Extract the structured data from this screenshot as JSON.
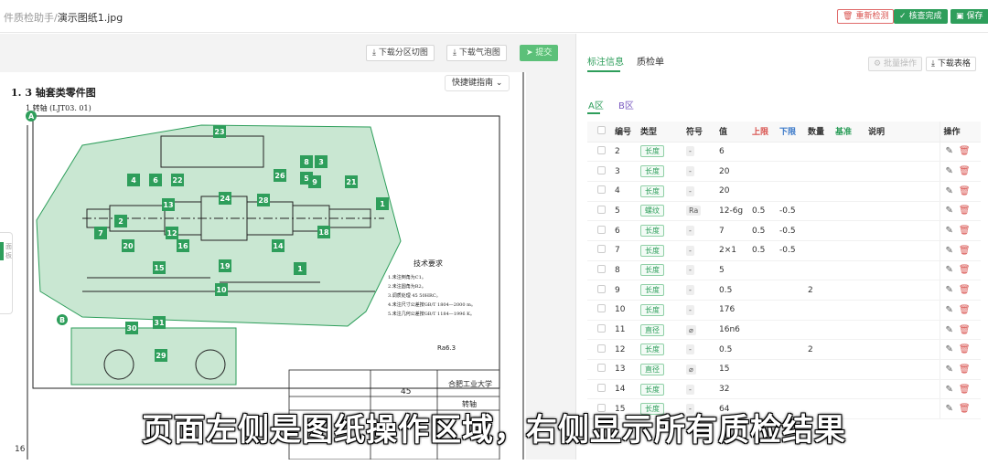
{
  "header": {
    "breadcrumb_parent": "件质检助手",
    "breadcrumb_sep": "/",
    "breadcrumb_current": "演示图纸1.jpg",
    "recheck_label": "重新检测",
    "complete_label": "核查完成",
    "save_label": "保存"
  },
  "drawing_toolbar": {
    "download_zones": "下载分区切图",
    "download_bubbles": "下载气泡图",
    "submit": "提交"
  },
  "drawing": {
    "shortcut_label": "快捷键指南",
    "section_title": "1. 3  轴套类零件图",
    "part_name": "1  转轴  (LJT03. 01)",
    "zone_a": "A",
    "zone_b": "B",
    "tech_title": "技术要求",
    "tech_lines": [
      "1.未注倒角为C1。",
      "2.未注圆角为R2。",
      "3.调质处理  45  50HRC。",
      "4.未注尺寸公差按GB/T 1804—2000  m。",
      "5.未注几何公差按GB/T 1184—1996  K。"
    ],
    "roughness": "Ra6.3",
    "material": "45",
    "school": "合肥工业大学",
    "drawing_name": "转轴",
    "sidetab_label": "面板",
    "page_number": "16",
    "bubbles": [
      "23",
      "4",
      "6",
      "22",
      "8",
      "3",
      "5",
      "26",
      "9",
      "21",
      "1",
      "13",
      "24",
      "28",
      "12",
      "20",
      "2",
      "7",
      "16",
      "14",
      "18",
      "15",
      "19",
      "1",
      "10",
      "30",
      "31",
      "29"
    ]
  },
  "panel": {
    "tab_marks": "标注信息",
    "tab_qc": "质检单",
    "batch_label": "批量操作",
    "download_table": "下载表格",
    "zone_a": "A区",
    "zone_b": "B区",
    "columns": [
      "编号",
      "类型",
      "符号",
      "值",
      "上限",
      "下限",
      "数量",
      "基准",
      "说明",
      "操作"
    ]
  },
  "rows": [
    {
      "id": "2",
      "type": "长度",
      "sym": "-",
      "val": "6",
      "up": "",
      "low": "",
      "qty": ""
    },
    {
      "id": "3",
      "type": "长度",
      "sym": "-",
      "val": "20",
      "up": "",
      "low": "",
      "qty": ""
    },
    {
      "id": "4",
      "type": "长度",
      "sym": "-",
      "val": "20",
      "up": "",
      "low": "",
      "qty": ""
    },
    {
      "id": "5",
      "type": "螺纹",
      "sym": "Ra",
      "val": "12-6g",
      "up": "0.5",
      "low": "-0.5",
      "qty": ""
    },
    {
      "id": "6",
      "type": "长度",
      "sym": "-",
      "val": "7",
      "up": "0.5",
      "low": "-0.5",
      "qty": ""
    },
    {
      "id": "7",
      "type": "长度",
      "sym": "-",
      "val": "2×1",
      "up": "0.5",
      "low": "-0.5",
      "qty": ""
    },
    {
      "id": "8",
      "type": "长度",
      "sym": "-",
      "val": "5",
      "up": "",
      "low": "",
      "qty": ""
    },
    {
      "id": "9",
      "type": "长度",
      "sym": "-",
      "val": "0.5",
      "up": "",
      "low": "",
      "qty": "2"
    },
    {
      "id": "10",
      "type": "长度",
      "sym": "-",
      "val": "176",
      "up": "",
      "low": "",
      "qty": ""
    },
    {
      "id": "11",
      "type": "直径",
      "sym": "⌀",
      "val": "16n6",
      "up": "",
      "low": "",
      "qty": ""
    },
    {
      "id": "12",
      "type": "长度",
      "sym": "-",
      "val": "0.5",
      "up": "",
      "low": "",
      "qty": "2"
    },
    {
      "id": "13",
      "type": "直径",
      "sym": "⌀",
      "val": "15",
      "up": "",
      "low": "",
      "qty": ""
    },
    {
      "id": "14",
      "type": "长度",
      "sym": "-",
      "val": "32",
      "up": "",
      "low": "",
      "qty": ""
    },
    {
      "id": "15",
      "type": "长度",
      "sym": "-",
      "val": "64",
      "up": "",
      "low": "",
      "qty": ""
    }
  ],
  "subtitle": "页面左侧是图纸操作区域，右侧显示所有质检结果",
  "colors": {
    "accent": "#2e9e5b",
    "danger": "#d9534f",
    "lower": "#3b79c9"
  }
}
